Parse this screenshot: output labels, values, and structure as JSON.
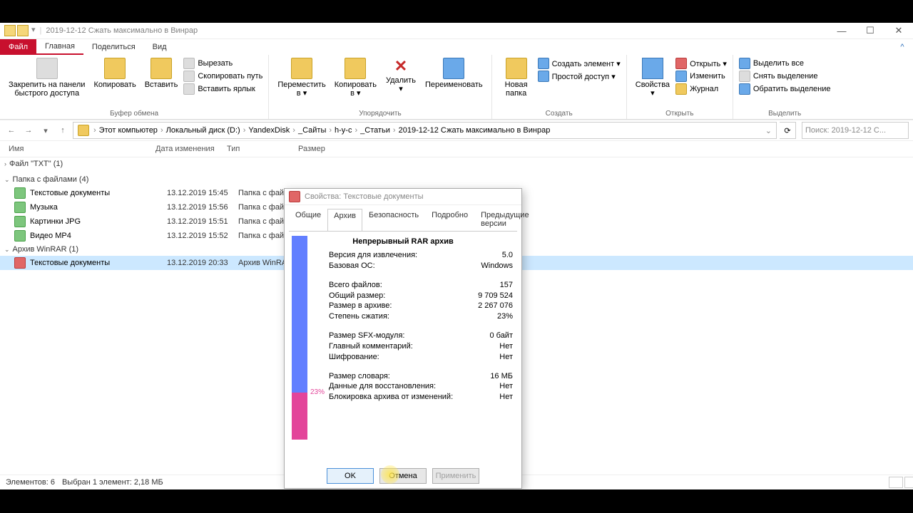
{
  "window": {
    "title": "2019-12-12 Сжать максимально в Винрар",
    "minimize": "—",
    "maximize": "☐",
    "close": "✕"
  },
  "tabs": {
    "file": "Файл",
    "home": "Главная",
    "share": "Поделиться",
    "view": "Вид",
    "help": "?"
  },
  "ribbon": {
    "clipboard": {
      "pin": "Закрепить на панели\nбыстрого доступа",
      "copy": "Копировать",
      "paste": "Вставить",
      "cut": "Вырезать",
      "copypath": "Скопировать путь",
      "pastelnk": "Вставить ярлык",
      "label": "Буфер обмена"
    },
    "organize": {
      "moveto": "Переместить\nв ▾",
      "copyto": "Копировать\nв ▾",
      "delete": "Удалить\n▾",
      "rename": "Переименовать",
      "label": "Упорядочить"
    },
    "new": {
      "newfolder": "Новая\nпапка",
      "newitem": "Создать элемент ▾",
      "easyaccess": "Простой доступ ▾",
      "label": "Создать"
    },
    "open": {
      "properties": "Свойства\n▾",
      "open": "Открыть ▾",
      "edit": "Изменить",
      "history": "Журнал",
      "label": "Открыть"
    },
    "select": {
      "all": "Выделить все",
      "none": "Снять выделение",
      "invert": "Обратить выделение",
      "label": "Выделить"
    }
  },
  "breadcrumb": [
    "Этот компьютер",
    "Локальный диск (D:)",
    "YandexDisk",
    "_Сайты",
    "h-y-c",
    "_Статьи",
    "2019-12-12 Сжать максимально в Винрар"
  ],
  "search_placeholder": "Поиск: 2019-12-12 С...",
  "columns": {
    "name": "Имя",
    "date": "Дата изменения",
    "type": "Тип",
    "size": "Размер"
  },
  "groups": {
    "txt": "Файл \"TXT\" (1)",
    "folders": "Папка с файлами (4)",
    "folder_items": [
      {
        "name": "Текстовые документы",
        "date": "13.12.2019 15:45",
        "type": "Папка с файлами"
      },
      {
        "name": "Музыка",
        "date": "13.12.2019 15:56",
        "type": "Папка с файлами"
      },
      {
        "name": "Картинки JPG",
        "date": "13.12.2019 15:51",
        "type": "Папка с файлами"
      },
      {
        "name": "Видео MP4",
        "date": "13.12.2019 15:52",
        "type": "Папка с файлами"
      }
    ],
    "rar": "Архив WinRAR (1)",
    "rar_items": [
      {
        "name": "Текстовые документы",
        "date": "13.12.2019 20:33",
        "type": "Архив WinRAR"
      }
    ]
  },
  "statusbar": {
    "count": "Элементов: 6",
    "selected": "Выбран 1 элемент: 2,18 МБ"
  },
  "dialog": {
    "title": "Свойства: Текстовые документы",
    "tabs": {
      "general": "Общие",
      "archive": "Архив",
      "security": "Безопасность",
      "details": "Подробно",
      "prev": "Предыдущие версии"
    },
    "header": "Непрерывный RAR архив",
    "ratio_label": "23%",
    "rows": [
      {
        "k": "Версия для извлечения:",
        "v": "5.0"
      },
      {
        "k": "Базовая ОС:",
        "v": "Windows"
      },
      {
        "gap": true
      },
      {
        "k": "Всего файлов:",
        "v": "157"
      },
      {
        "k": "Общий размер:",
        "v": "9 709 524"
      },
      {
        "k": "Размер в архиве:",
        "v": "2 267 076"
      },
      {
        "k": "Степень сжатия:",
        "v": "23%"
      },
      {
        "gap": true
      },
      {
        "k": "Размер SFX-модуля:",
        "v": "0 байт"
      },
      {
        "k": "Главный комментарий:",
        "v": "Нет"
      },
      {
        "k": "Шифрование:",
        "v": "Нет"
      },
      {
        "gap": true
      },
      {
        "k": "Размер словаря:",
        "v": "16 МБ"
      },
      {
        "k": "Данные для восстановления:",
        "v": "Нет"
      },
      {
        "k": "Блокировка архива от изменений:",
        "v": "Нет"
      }
    ],
    "buttons": {
      "ok": "OK",
      "cancel": "Отмена",
      "apply": "Применить"
    },
    "ratio_pct": 23
  }
}
